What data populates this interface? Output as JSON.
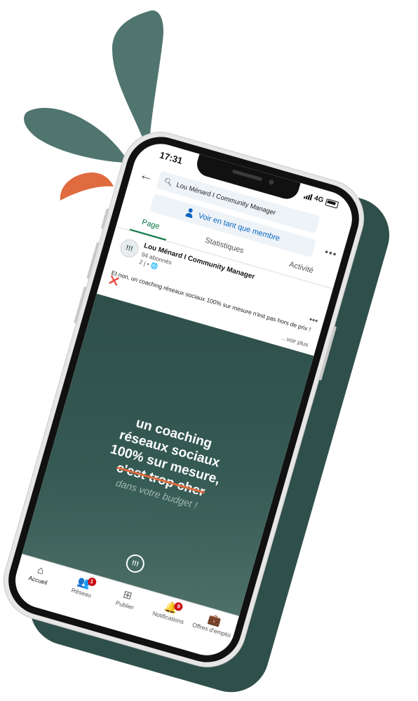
{
  "colors": {
    "brand_green": "#2f4f4a",
    "accent_orange": "#e06b3f",
    "linkedin_blue": "#0a66c2",
    "active_tab_green": "#057642",
    "badge_red": "#cc1016"
  },
  "status_bar": {
    "time": "17:31",
    "network": "4G"
  },
  "header": {
    "back_icon": "arrow-left-icon",
    "search_icon": "search-icon",
    "search_text": "Lou Ménard I Community Manager",
    "member_button_label": "Voir en tant que membre",
    "more_icon": "more-horizontal-icon"
  },
  "tabs": [
    {
      "label": "Page",
      "active": true
    },
    {
      "label": "Statistiques",
      "active": false
    },
    {
      "label": "Activité",
      "active": false
    }
  ],
  "post": {
    "author": "Lou Ménard I Community Manager",
    "followers": "94 abonnés",
    "meta": "2 j • 🌐",
    "text": "Et non, un coaching réseaux sociaux 100% sur mesure n'est pas hors de prix !",
    "cross_icon": "❌",
    "see_more": "...voir plus",
    "logo_mark": "!!!"
  },
  "post_image": {
    "line1": "un coaching",
    "line2": "réseaux sociaux",
    "line3": "100% sur mesure,",
    "line4_struck": "c'est trop cher",
    "line5": "dans votre budget !",
    "logo_mark": "!!!"
  },
  "bottom_nav": [
    {
      "label": "Accueil",
      "icon": "home-icon",
      "glyph": "⌂",
      "active": true,
      "badge": ""
    },
    {
      "label": "Réseau",
      "icon": "network-icon",
      "glyph": "👥",
      "active": false,
      "badge": "1"
    },
    {
      "label": "Publier",
      "icon": "add-post-icon",
      "glyph": "⊞",
      "active": false,
      "badge": ""
    },
    {
      "label": "Notifications",
      "icon": "bell-icon",
      "glyph": "🔔",
      "active": false,
      "badge": "9"
    },
    {
      "label": "Offres d'emploi",
      "icon": "briefcase-icon",
      "glyph": "💼",
      "active": false,
      "badge": ""
    }
  ]
}
